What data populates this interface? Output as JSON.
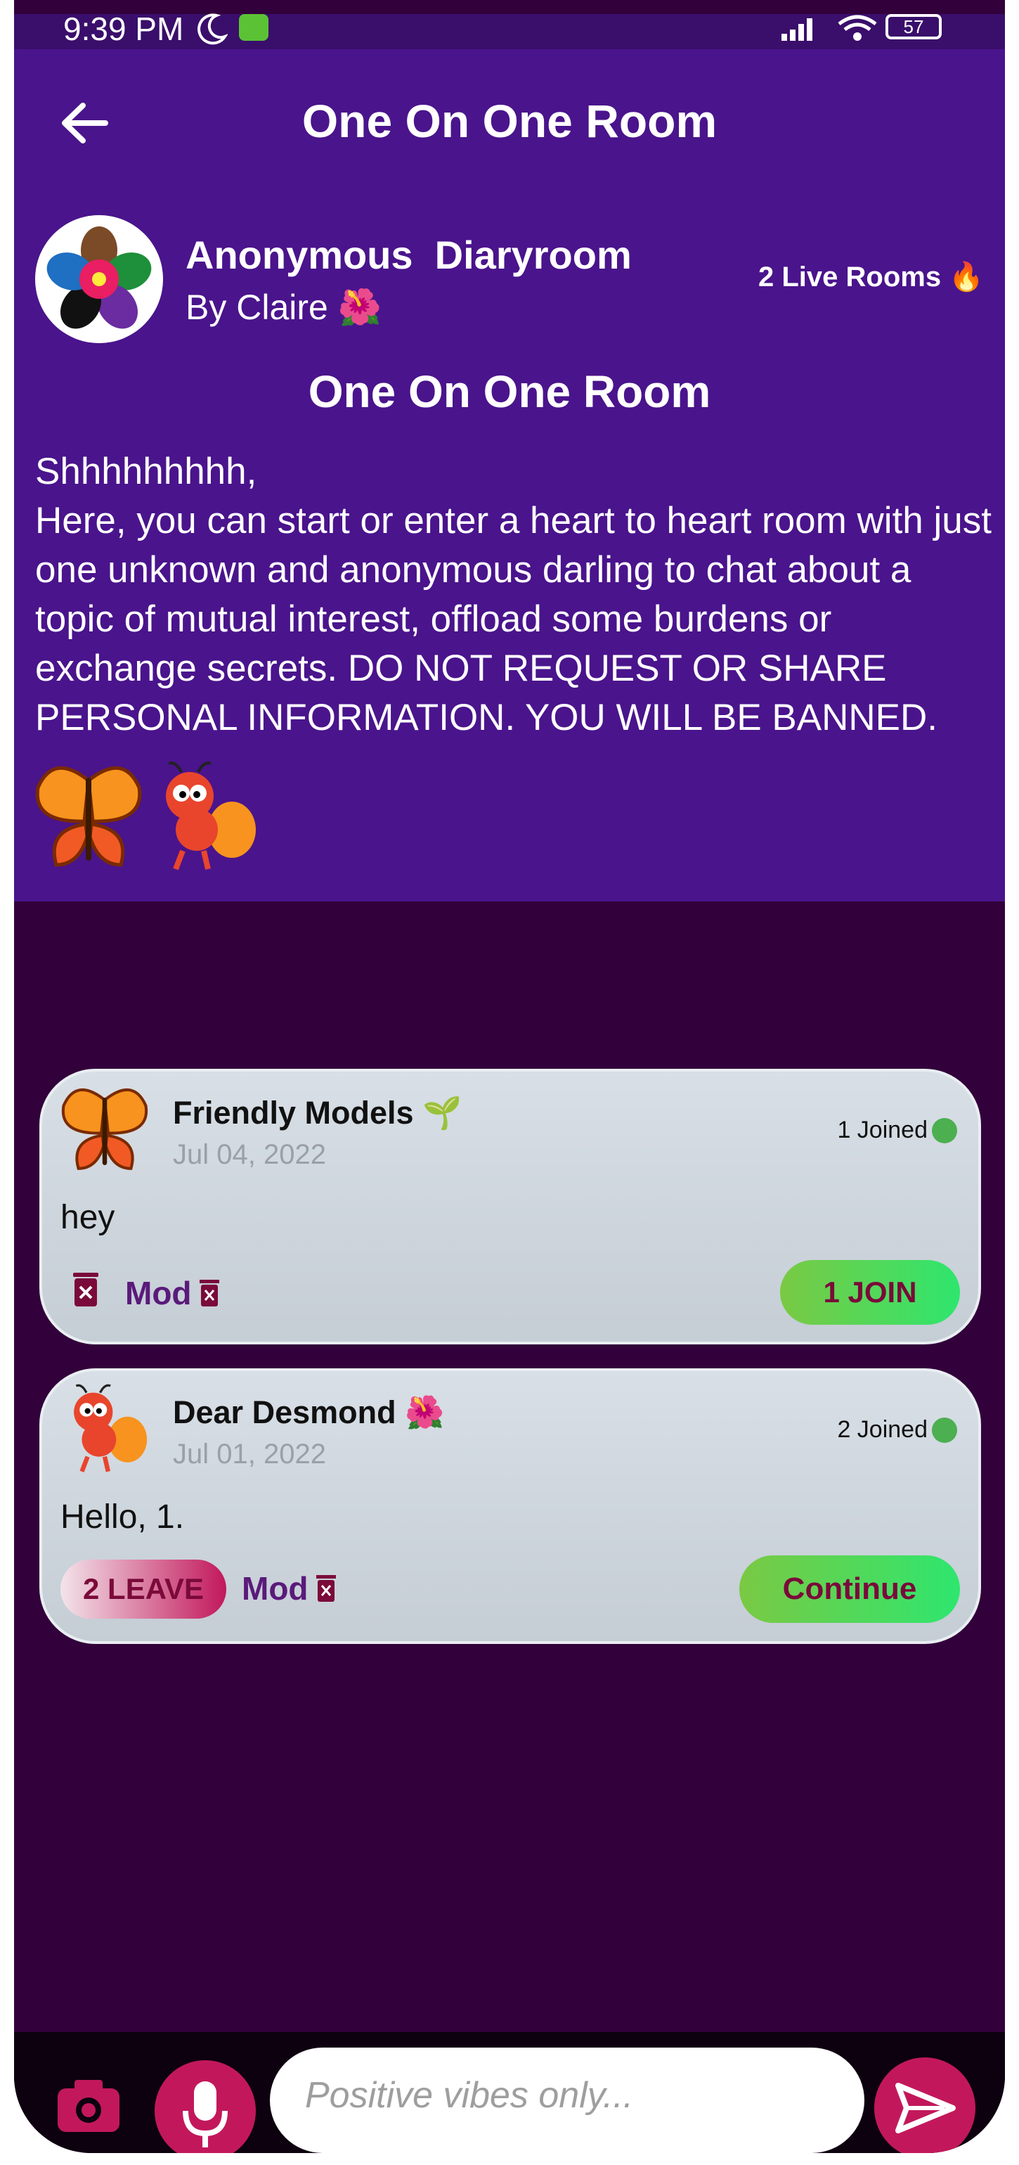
{
  "status_bar": {
    "time": "9:39 PM",
    "battery": "57"
  },
  "appbar": {
    "title": "One On One Room"
  },
  "room": {
    "name": "Anonymous  Diaryroom",
    "by": "By Claire 🌺",
    "live_rooms": "2 Live Rooms 🔥",
    "section_title": "One On One Room",
    "description": "Shhhhhhhhh,\nHere, you can start or enter a heart to heart room with just one unknown and anonymous darling to chat about a topic of mutual interest, offload some burdens or exchange secrets. DO NOT REQUEST OR SHARE PERSONAL INFORMATION. YOU WILL BE BANNED."
  },
  "cards": [
    {
      "title": "Friendly Models 🌱",
      "date": "Jul 04, 2022",
      "joined": "1 Joined",
      "message": "hey",
      "mod_label": "Mod",
      "action_label": "1 JOIN",
      "avatar_icon": "butterfly-icon"
    },
    {
      "title": "Dear Desmond 🌺",
      "date": "Jul 01, 2022",
      "joined": "2 Joined",
      "message": "Hello, 1.",
      "mod_label": "Mod",
      "leave_label": "2 LEAVE",
      "action_label": "Continue",
      "avatar_icon": "ant-icon"
    }
  ],
  "composer": {
    "placeholder": "Positive vibes only..."
  },
  "colors": {
    "header_bg": "#4a148c",
    "page_bg": "#32003a",
    "accent_pink": "#c2185b",
    "join_green": "#2ee66e",
    "online_dot": "#4caf50"
  }
}
